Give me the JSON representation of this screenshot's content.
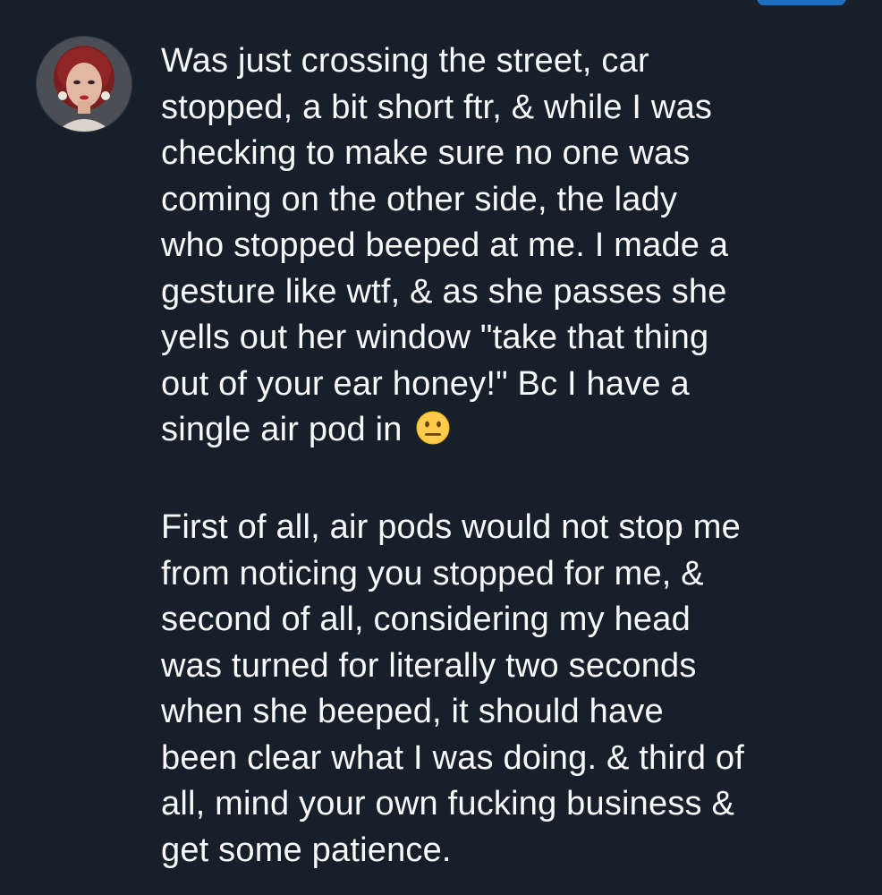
{
  "post": {
    "avatar_icon": "user-avatar-photo",
    "paragraph_1": [
      "Was just crossing the street, car",
      "stopped, a bit short ftr, & while I was",
      "checking to make sure no one was",
      "coming on the other side, the lady",
      "who stopped beeped at me. I made a",
      "gesture like wtf, & as she passes she",
      "yells out her window \"take that thing",
      "out of your ear honey!\" Bc I have a",
      "single air pod in "
    ],
    "emoji": "neutral-face-emoji",
    "paragraph_2": [
      "First of all, air pods would not stop me",
      "from noticing you stopped for me, &",
      "second of all, considering my head",
      "was turned for literally two seconds",
      "when she beeped, it should have",
      "been clear what I was doing. & third of",
      "all, mind your own fucking business &",
      "get some patience."
    ]
  },
  "colors": {
    "background": "#17202a",
    "text": "#f7f9f9",
    "accent": "#1d6fc2"
  }
}
